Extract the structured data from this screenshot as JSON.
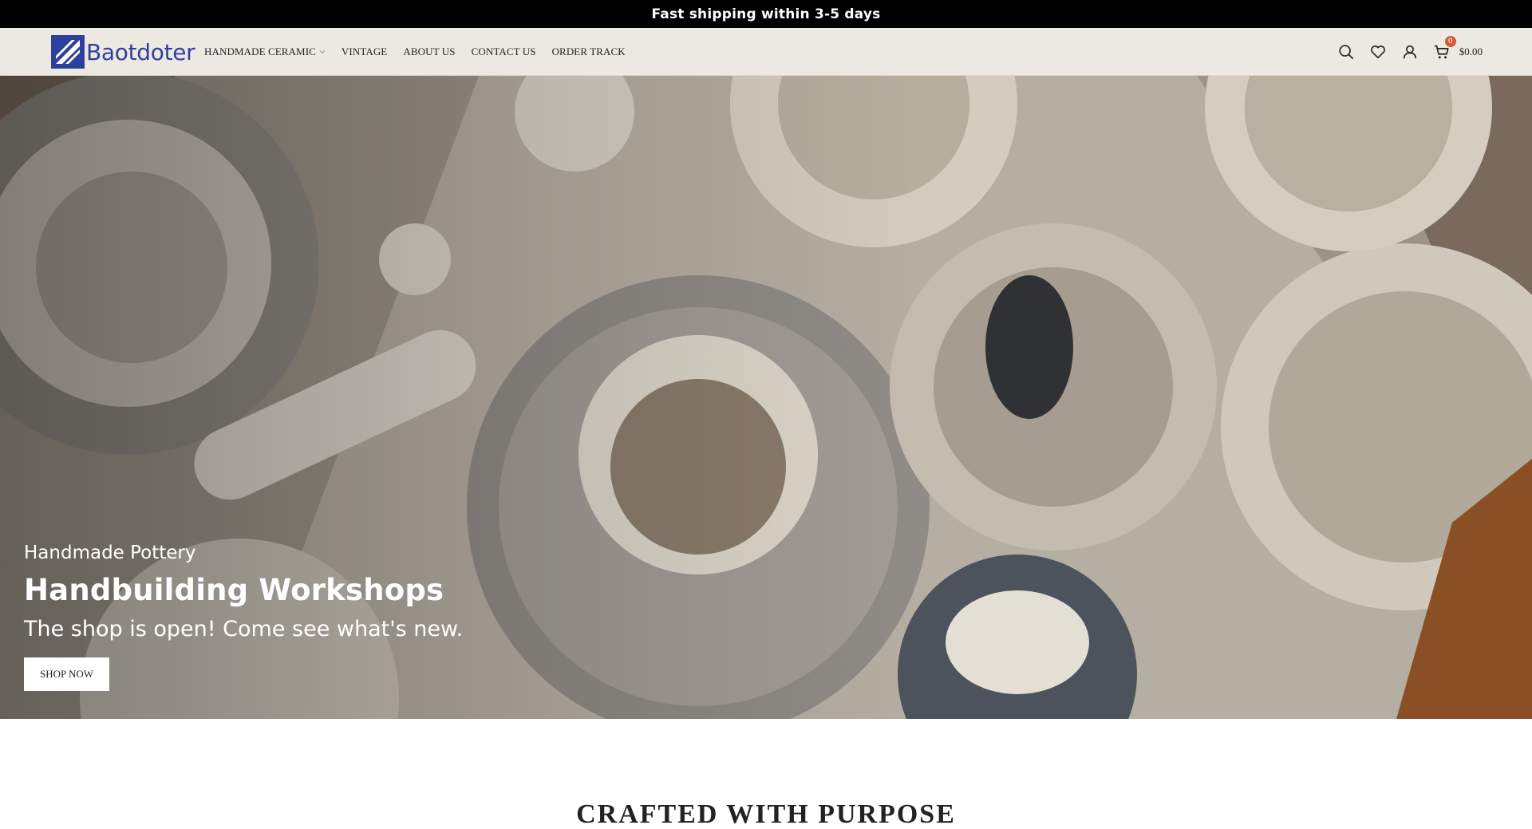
{
  "announcement": {
    "text": "Fast shipping within 3-5 days"
  },
  "brand": {
    "name": "Baotdoter",
    "color": "#2e3f9e"
  },
  "nav": {
    "items": [
      {
        "label": "HANDMADE CERAMIC",
        "has_dropdown": true
      },
      {
        "label": "VINTAGE"
      },
      {
        "label": "ABOUT US"
      },
      {
        "label": "CONTACT US"
      },
      {
        "label": "ORDER TRACK"
      }
    ]
  },
  "tools": {
    "icons": [
      "search-icon",
      "heart-icon",
      "user-icon",
      "cart-icon"
    ],
    "cart_count": "0",
    "cart_total": "$0.00",
    "badge_color": "#d8573a"
  },
  "hero": {
    "eyebrow": "Handmade Pottery",
    "headline": "Handbuilding Workshops",
    "subline": "The shop is open! Come see what's new.",
    "cta": "SHOP NOW"
  },
  "section": {
    "title": "CRAFTED WITH PURPOSE"
  }
}
